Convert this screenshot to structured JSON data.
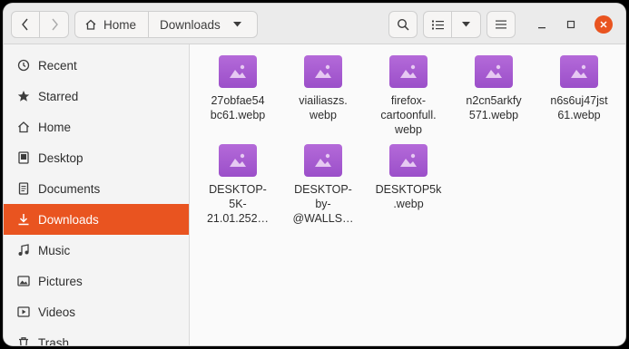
{
  "path": {
    "home_label": "Home",
    "current": "Downloads"
  },
  "sidebar": {
    "items": [
      {
        "label": "Recent",
        "icon": "clock-icon"
      },
      {
        "label": "Starred",
        "icon": "star-icon"
      },
      {
        "label": "Home",
        "icon": "home-icon"
      },
      {
        "label": "Desktop",
        "icon": "desktop-folder-icon"
      },
      {
        "label": "Documents",
        "icon": "document-icon"
      },
      {
        "label": "Downloads",
        "icon": "download-icon",
        "active": true
      },
      {
        "label": "Music",
        "icon": "music-icon"
      },
      {
        "label": "Pictures",
        "icon": "pictures-icon"
      },
      {
        "label": "Videos",
        "icon": "video-icon"
      },
      {
        "label": "Trash",
        "icon": "trash-icon"
      }
    ]
  },
  "files": [
    {
      "name": "27obfae54\nbc61.webp"
    },
    {
      "name": "viailiaszs.\nwebp"
    },
    {
      "name": "firefox-\ncartoonfull.\nwebp"
    },
    {
      "name": "n2cn5arkfy\n571.webp"
    },
    {
      "name": "n6s6uj47jst\n61.webp"
    },
    {
      "name": "DESKTOP-\n5K-\n21.01.252…"
    },
    {
      "name": "DESKTOP-\nby-\n@WALLS…"
    },
    {
      "name": "DESKTOP5k\n.webp"
    }
  ],
  "colors": {
    "accent": "#e95420",
    "file_icon": "#a55bd1"
  }
}
